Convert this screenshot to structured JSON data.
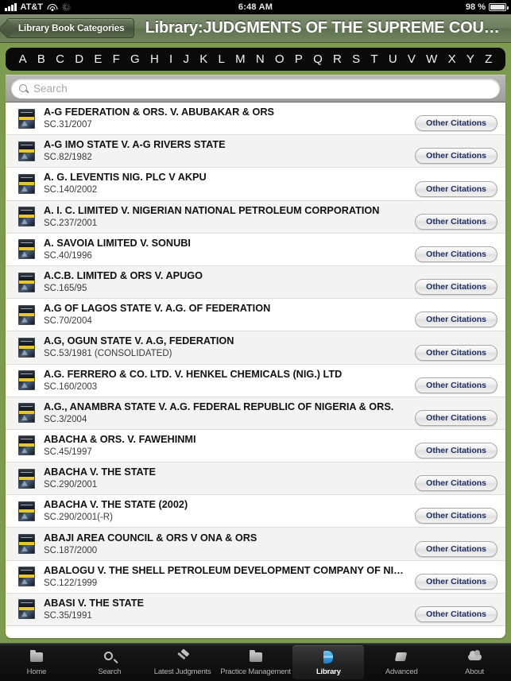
{
  "statusbar": {
    "carrier": "AT&T",
    "time": "6:48 AM",
    "battery": "98 %",
    "signal_icon": "signal-bars-icon",
    "wifi_icon": "wifi-icon",
    "activity_icon": "activity-spinner-icon",
    "battery_icon": "battery-icon"
  },
  "navbar": {
    "back_label": "Library Book Categories",
    "title": "Library:JUDGMENTS OF THE SUPREME COURT AND…"
  },
  "alphabet": [
    "A",
    "B",
    "C",
    "D",
    "E",
    "F",
    "G",
    "H",
    "I",
    "J",
    "K",
    "L",
    "M",
    "N",
    "O",
    "P",
    "Q",
    "R",
    "S",
    "T",
    "U",
    "V",
    "W",
    "X",
    "Y",
    "Z"
  ],
  "search": {
    "placeholder": "Search",
    "value": "",
    "icon": "search-icon"
  },
  "list": {
    "citations_label": "Other Citations",
    "book_icon": "book-cover-icon",
    "rows": [
      {
        "title": "A-G FEDERATION & ORS. V. ABUBAKAR & ORS",
        "citation": "SC.31/2007"
      },
      {
        "title": "A-G IMO STATE V. A-G RIVERS STATE",
        "citation": "SC.82/1982"
      },
      {
        "title": "A. G. LEVENTIS NIG. PLC V AKPU",
        "citation": "SC.140/2002"
      },
      {
        "title": "A. I. C. LIMITED  V. NIGERIAN NATIONAL PETROLEUM CORPORATION",
        "citation": "SC.237/2001"
      },
      {
        "title": "A. SAVOIA LIMITED V. SONUBI",
        "citation": "SC.40/1996"
      },
      {
        "title": "A.C.B. LIMITED & ORS V. APUGO",
        "citation": "SC.165/95"
      },
      {
        "title": "A.G OF LAGOS STATE V. A.G. OF FEDERATION",
        "citation": "SC.70/2004"
      },
      {
        "title": "A.G, OGUN STATE  V.  A.G, FEDERATION",
        "citation": "SC.53/1981 (CONSOLIDATED)"
      },
      {
        "title": "A.G. FERRERO & CO. LTD. V. HENKEL CHEMICALS (NIG.) LTD",
        "citation": "SC.160/2003"
      },
      {
        "title": "A.G., ANAMBRA STATE V. A.G. FEDERAL REPUBLIC OF NIGERIA & ORS.",
        "citation": "SC.3/2004"
      },
      {
        "title": "ABACHA & ORS. V. FAWEHINMI",
        "citation": "SC.45/1997"
      },
      {
        "title": "ABACHA V. THE STATE",
        "citation": "SC.290/2001"
      },
      {
        "title": "ABACHA V. THE STATE (2002)",
        "citation": "SC.290/2001(-R)"
      },
      {
        "title": "ABAJI AREA COUNCIL & ORS V ONA & ORS",
        "citation": "SC.187/2000"
      },
      {
        "title": "ABALOGU V. THE SHELL PETROLEUM DEVELOPMENT COMPANY OF NIGERIA LIMITED",
        "citation": "SC.122/1999"
      },
      {
        "title": "ABASI V. THE STATE",
        "citation": "SC.35/1991"
      }
    ]
  },
  "tabbar": {
    "tabs": [
      {
        "label": "Home",
        "icon": "folder-icon",
        "selected": false
      },
      {
        "label": "Search",
        "icon": "magnifier-icon",
        "selected": false
      },
      {
        "label": "Latest Judgments",
        "icon": "gavel-icon",
        "selected": false
      },
      {
        "label": "Practice Management",
        "icon": "folder-icon",
        "selected": false
      },
      {
        "label": "Library",
        "icon": "blue-book-icon",
        "selected": true
      },
      {
        "label": "Advanced",
        "icon": "tag-icon",
        "selected": false
      },
      {
        "label": "About",
        "icon": "cloud-icon",
        "selected": false
      }
    ]
  },
  "colors": {
    "brand_green": "#7d9b4e",
    "navbar_green": "#6d7f5e",
    "accent_blue": "#1e2f66",
    "tab_selected_blue": "#2f9fe0"
  }
}
